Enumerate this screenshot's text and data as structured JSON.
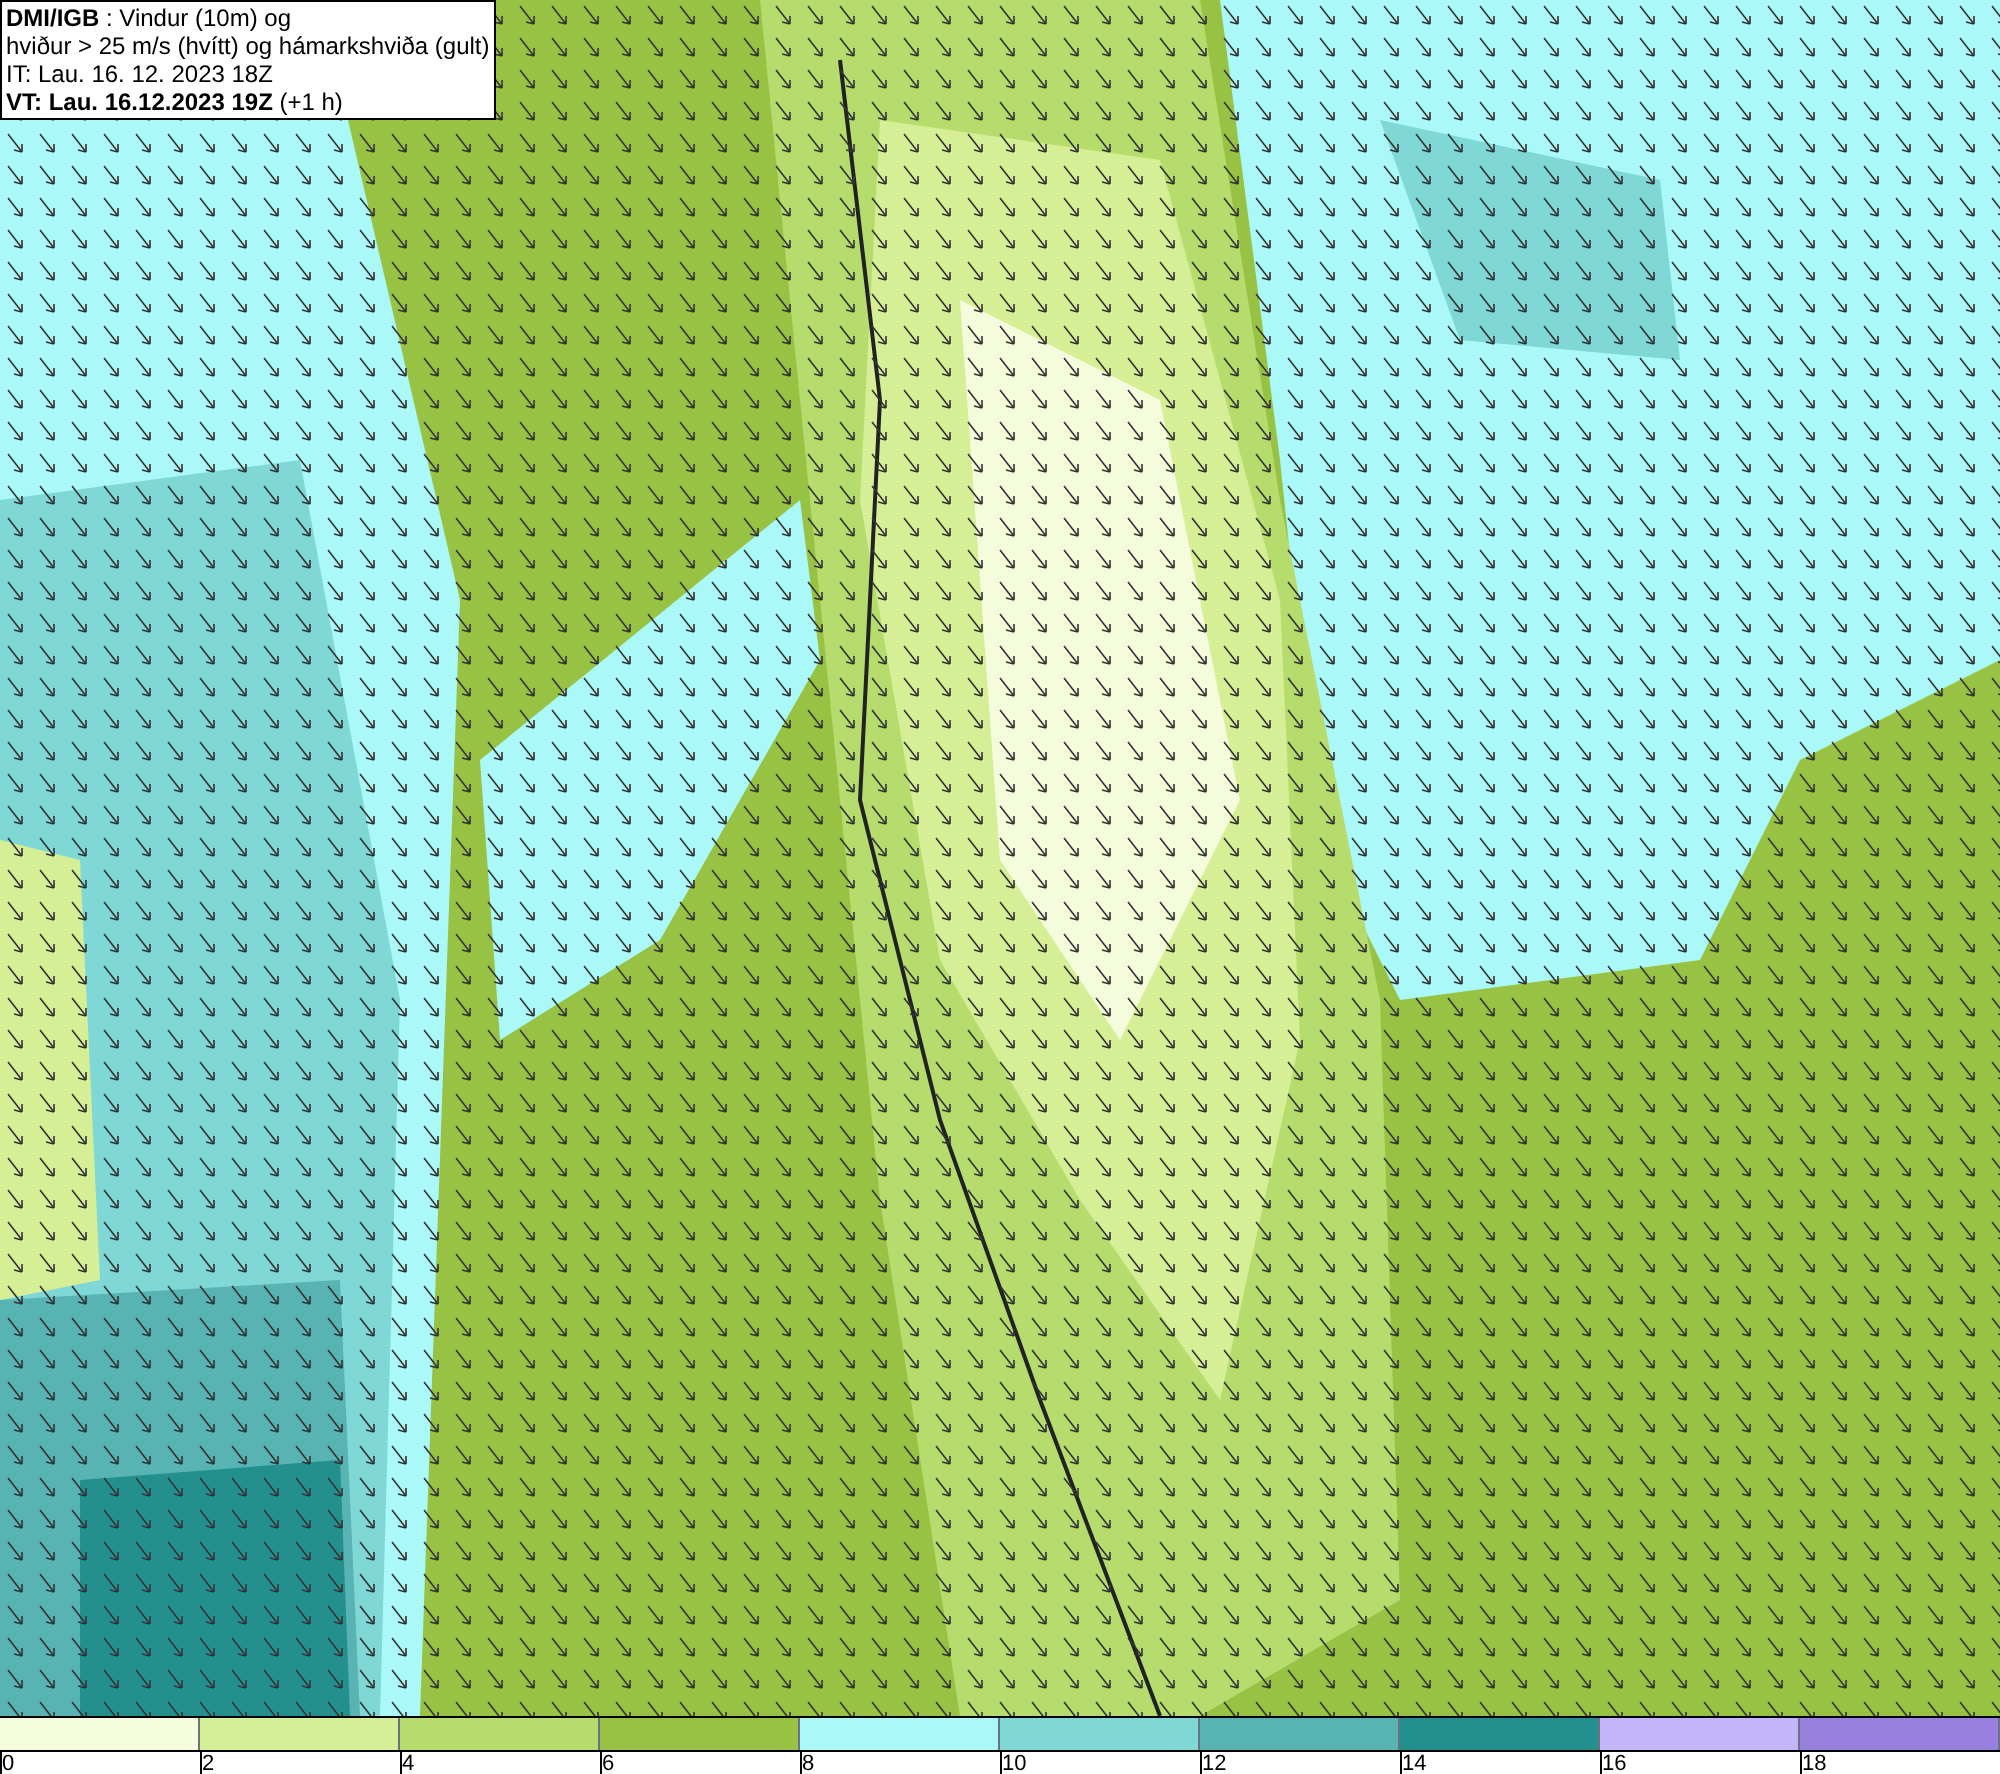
{
  "header": {
    "lines": [
      "**DMI/IGB** : Vindur (10m) og",
      "hviður > 25 m/s (hvítt) og hámarkshviða (gult)",
      "IT: Lau. 16. 12. 2023 18Z",
      "**VT: Lau. 16.12.2023 19Z** (+1 h)"
    ]
  },
  "legend": {
    "bins": [
      {
        "label": "0",
        "color": "#f4fcdc"
      },
      {
        "label": "2",
        "color": "#d6ef96"
      },
      {
        "label": "4",
        "color": "#b6dc6e"
      },
      {
        "label": "6",
        "color": "#98c243"
      },
      {
        "label": "8",
        "color": "#aaf8f8"
      },
      {
        "label": "10",
        "color": "#7fd8d6"
      },
      {
        "label": "12",
        "color": "#57b4b3"
      },
      {
        "label": "14",
        "color": "#23908e"
      },
      {
        "label": "16",
        "color": "#c4b4f8"
      },
      {
        "label": "18",
        "color": "#9880de"
      }
    ]
  }
}
